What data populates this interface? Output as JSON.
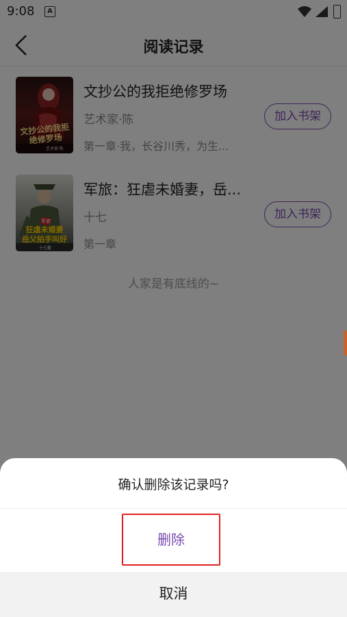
{
  "status_bar": {
    "time": "9:08",
    "notification_icon": "a-letter-icon",
    "wifi_icon": "wifi-icon",
    "signal_icon": "signal-icon",
    "battery_icon": "battery-charging-icon"
  },
  "header": {
    "title": "阅读记录",
    "back_icon": "chevron-left-icon"
  },
  "books": [
    {
      "title": "文抄公的我拒绝修罗场",
      "author": "艺术家·陈",
      "chapter": "第一章·我，长谷川秀，为生...",
      "button": "加入书架",
      "cover_text": "文抄公的我拒绝修罗场",
      "cover_small": "艺术家·陈"
    },
    {
      "title": "军旅：狂虐未婚妻，岳...",
      "author": "十七",
      "chapter": "第一章",
      "button": "加入书架",
      "cover_text_top": "军旅",
      "cover_text_line1": "狂虐未婚妻",
      "cover_text_line2": "岳父拍手叫好",
      "cover_small": "十七著"
    }
  ],
  "list_end": "人家是有底线的~",
  "dialog": {
    "title": "确认删除该记录吗?",
    "delete": "删除",
    "cancel": "取消"
  },
  "colors": {
    "accent": "#7a4bb0",
    "highlight_border": "#e02020",
    "overlay": "rgba(0,0,0,0.5)"
  }
}
